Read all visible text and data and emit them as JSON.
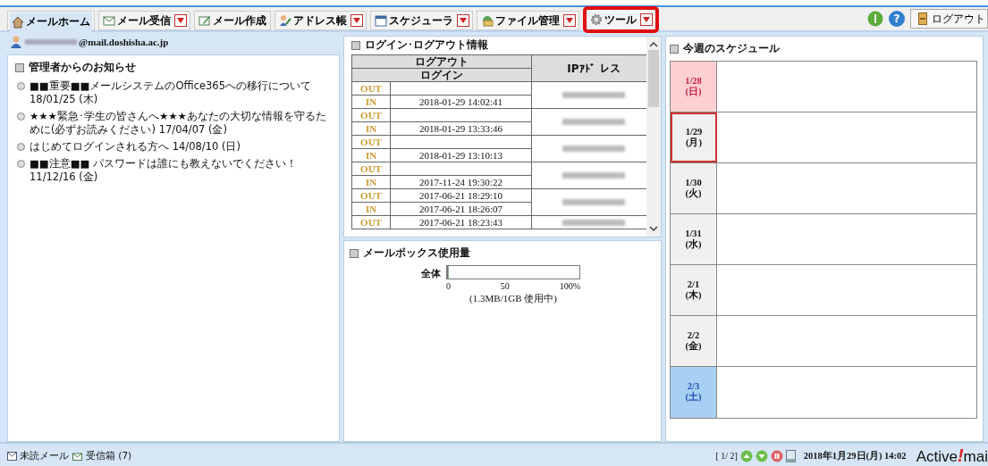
{
  "toolbar": {
    "tabs": [
      {
        "label": "メールホーム",
        "selected": true,
        "has_menu": false,
        "highlighted": false
      },
      {
        "label": "メール受信",
        "selected": false,
        "has_menu": true,
        "highlighted": false
      },
      {
        "label": "メール作成",
        "selected": false,
        "has_menu": false,
        "highlighted": false
      },
      {
        "label": "アドレス帳",
        "selected": false,
        "has_menu": true,
        "highlighted": false
      },
      {
        "label": "スケジューラ",
        "selected": false,
        "has_menu": true,
        "highlighted": false
      },
      {
        "label": "ファイル管理",
        "selected": false,
        "has_menu": true,
        "highlighted": false
      },
      {
        "label": "ツール",
        "selected": false,
        "has_menu": true,
        "highlighted": true
      }
    ],
    "help": "?",
    "logout": "ログアウト"
  },
  "user": {
    "address": "@mail.doshisha.ac.jp"
  },
  "notices": {
    "title": "管理者からのお知らせ",
    "items": [
      "■■重要■■メールシステムのOffice365への移行について 18/01/25 (木)",
      "★★★緊急･学生の皆さんへ★★★あなたの大切な情報を守るために(必ずお読みください) 17/04/07 (金)",
      "はじめてログインされる方へ 14/08/10 (日)",
      "■■注意■■ パスワードは誰にも教えないでください！ 11/12/16 (金)"
    ]
  },
  "login_log": {
    "title": "ログイン･ログアウト情報",
    "header": {
      "logout": "ログアウト",
      "login": "ログイン",
      "ip": "IPｱﾄﾞ レス"
    },
    "groups": [
      {
        "rows": [
          {
            "type": "OUT",
            "time": ""
          },
          {
            "type": "IN",
            "time": "2018-01-29 14:02:41"
          }
        ]
      },
      {
        "rows": [
          {
            "type": "OUT",
            "time": ""
          },
          {
            "type": "IN",
            "time": "2018-01-29 13:33:46"
          }
        ]
      },
      {
        "rows": [
          {
            "type": "OUT",
            "time": ""
          },
          {
            "type": "IN",
            "time": "2018-01-29 13:10:13"
          }
        ]
      },
      {
        "rows": [
          {
            "type": "OUT",
            "time": ""
          },
          {
            "type": "IN",
            "time": "2017-11-24 19:30:22"
          }
        ]
      },
      {
        "rows": [
          {
            "type": "OUT",
            "time": "2017-06-21 18:29:10"
          },
          {
            "type": "IN",
            "time": "2017-06-21 18:26:07"
          }
        ]
      },
      {
        "rows": [
          {
            "type": "OUT",
            "time": "2017-06-21 18:23:43"
          }
        ]
      }
    ]
  },
  "mailbox": {
    "title": "メールボックス使用量",
    "label": "全体",
    "level": 0.01,
    "ticks": [
      "0",
      "50",
      "100%"
    ],
    "usage": "(1.3MB/1GB 使用中)"
  },
  "schedule": {
    "title": "今週のスケジュール",
    "days": [
      {
        "date": "1/28",
        "weekday": "(日)",
        "kind": "sunday",
        "today": false
      },
      {
        "date": "1/29",
        "weekday": "(月)",
        "kind": "weekday",
        "today": true
      },
      {
        "date": "1/30",
        "weekday": "(火)",
        "kind": "weekday",
        "today": false
      },
      {
        "date": "1/31",
        "weekday": "(水)",
        "kind": "weekday",
        "today": false
      },
      {
        "date": "2/1",
        "weekday": "(木)",
        "kind": "weekday",
        "today": false
      },
      {
        "date": "2/2",
        "weekday": "(金)",
        "kind": "weekday",
        "today": false
      },
      {
        "date": "2/3",
        "weekday": "(土)",
        "kind": "saturday",
        "today": false
      }
    ]
  },
  "status_bar": {
    "unread": "未読メール",
    "inbox": "受信箱 (7)",
    "page": "[ 1/ 2]",
    "datetime": "2018年1月29日(月) 14:02",
    "logo": [
      "Active",
      "!",
      "mai"
    ]
  }
}
